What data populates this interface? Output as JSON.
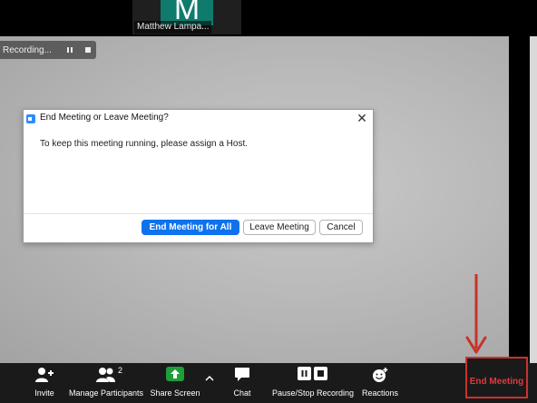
{
  "thumbnail": {
    "initial": "M",
    "name": "Matthew Lampa..."
  },
  "recording": {
    "label": "Recording..."
  },
  "dialog": {
    "title": "End Meeting or Leave Meeting?",
    "message": "To keep this meeting running, please assign a Host.",
    "close_icon": "close-icon",
    "buttons": {
      "end_all": "End Meeting for All",
      "leave": "Leave Meeting",
      "cancel": "Cancel"
    }
  },
  "toolbar": {
    "invite": "Invite",
    "manage_participants": "Manage Participants",
    "participants_count": "2",
    "share_screen": "Share Screen",
    "chat": "Chat",
    "pause_stop_recording": "Pause/Stop Recording",
    "reactions": "Reactions",
    "end_meeting": "End Meeting"
  },
  "colors": {
    "primary_blue": "#0e72ed",
    "share_green": "#1f9d3a",
    "end_red": "#e0393e",
    "annotation_red": "#c8332b",
    "avatar_teal": "#0f7b6c"
  }
}
